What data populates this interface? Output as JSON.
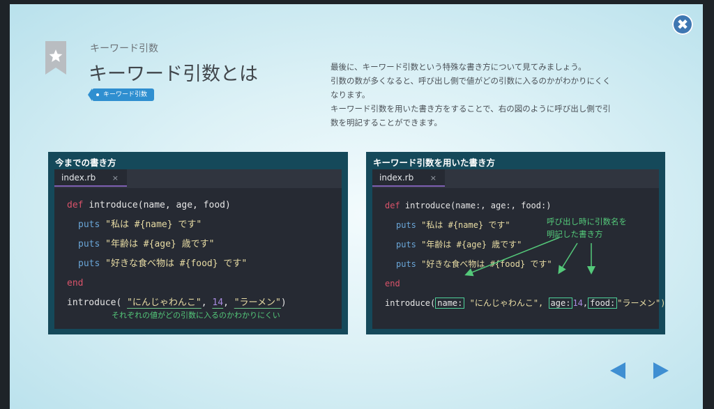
{
  "header": {
    "subtitle": "キーワード引数",
    "title": "キーワード引数とは",
    "tag": "キーワード引数"
  },
  "description": [
    "最後に、キーワード引数という特殊な書き方について見てみましょう。",
    "引数の数が多くなると、呼び出し側で値がどの引数に入るのかがわかりにくく",
    "なります。",
    "キーワード引数を用いた書き方をすることで、右の図のように呼び出し側で引",
    "数を明記することができます。"
  ],
  "left_panel": {
    "title": "今までの書き方",
    "tab": "index.rb",
    "tab_close": "×",
    "code": {
      "def": "def",
      "signature": "introduce(name, age, food)",
      "puts": "puts",
      "line1": "\"私は #{name} です\"",
      "line2": "\"年齢は #{age} 歳です\"",
      "line3": "\"好きな食べ物は #{food} です\"",
      "end": "end",
      "call_name": "introduce(",
      "arg1": "\"にんじゃわんこ\"",
      "comma1": ",",
      "arg2": "14",
      "comma2": ",",
      "arg3": "\"ラーメン\"",
      "close": ")"
    },
    "note": "それぞれの値がどの引数に入るのかわかりにくい"
  },
  "right_panel": {
    "title": "キーワード引数を用いた書き方",
    "tab": "index.rb",
    "tab_close": "×",
    "code": {
      "def": "def",
      "signature": "introduce(name:, age:, food:)",
      "puts": "puts",
      "line1": "\"私は #{name} です\"",
      "line2": "\"年齢は #{age} 歳です\"",
      "line3": "\"好きな食べ物は #{food} です\"",
      "end": "end",
      "call_name": "introduce(",
      "key1": "name:",
      "arg1": "\"にんじゃわんこ\",",
      "key2": "age:",
      "arg2": "14",
      "comma2": ",",
      "key3": "food:",
      "arg3": "\"ラーメン\")"
    },
    "note_line1": "呼び出し時に引数名を",
    "note_line2": "明記した書き方"
  },
  "controls": {
    "close_icon": "close-icon",
    "close_glyph": "✖",
    "prev_icon": "triangle-left-icon",
    "next_icon": "triangle-right-icon"
  },
  "colors": {
    "accent_blue": "#3f77b2",
    "panel_teal": "#15495a",
    "editor_bg": "#262a33",
    "keyword": "#d9536a",
    "method": "#6aa6d8",
    "string": "#e8dca4",
    "number": "#a88be0",
    "annotation": "#54c97a"
  }
}
